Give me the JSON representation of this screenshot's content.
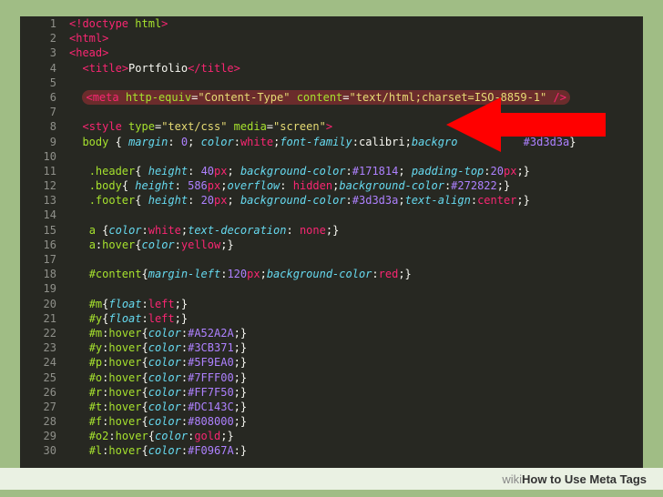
{
  "footer": {
    "brand": "wiki",
    "title": "How to Use Meta Tags"
  },
  "lines": [
    {
      "n": 1,
      "html": "<span class='t-br'>&lt;!</span><span class='t-tag'>doctype</span> <span class='t-attr'>html</span><span class='t-br'>&gt;</span>"
    },
    {
      "n": 2,
      "html": "<span class='t-br'>&lt;</span><span class='t-tag'>html</span><span class='t-br'>&gt;</span>"
    },
    {
      "n": 3,
      "html": "<span class='t-br'>&lt;</span><span class='t-tag'>head</span><span class='t-br'>&gt;</span>"
    },
    {
      "n": 4,
      "html": "  <span class='t-br'>&lt;</span><span class='t-tag'>title</span><span class='t-br'>&gt;</span><span class='t-text'>Portfolio</span><span class='t-br'>&lt;/</span><span class='t-tag'>title</span><span class='t-br'>&gt;</span>"
    },
    {
      "n": 5,
      "html": ""
    },
    {
      "n": 6,
      "html": "  <span class='hl'><span class='t-br'>&lt;</span><span class='t-tag'>meta</span> <span class='t-attr'>http-equiv</span><span class='t-punc'>=</span><span class='t-str'>\"Content-Type\"</span> <span class='t-attr'>content</span><span class='t-punc'>=</span><span class='t-str'>\"text/html;charset=ISO-8859-1\"</span> <span class='t-br'>/&gt;</span></span>"
    },
    {
      "n": 7,
      "html": ""
    },
    {
      "n": 8,
      "html": "  <span class='t-br'>&lt;</span><span class='t-tag'>style</span> <span class='t-attr'>type</span><span class='t-punc'>=</span><span class='t-str'>\"text/css\"</span> <span class='t-attr'>media</span><span class='t-punc'>=</span><span class='t-str'>\"screen\"</span><span class='t-br'>&gt;</span>"
    },
    {
      "n": 9,
      "html": "  <span class='t-sel'>body</span> <span class='t-punc'>{</span> <span class='t-prop'>margin</span><span class='t-punc'>:</span> <span class='t-num'>0</span><span class='t-punc'>;</span> <span class='t-prop'>color</span><span class='t-punc'>:</span><span class='t-key'>white</span><span class='t-punc'>;</span><span class='t-prop'>font-family</span><span class='t-punc'>:</span><span class='t-text'>calibri</span><span class='t-punc'>;</span><span class='t-prop'>backgro</span><span style='visibility:hidden'>und-color:</span><span class='t-num'>#3d3d3a</span><span class='t-punc'>}</span>"
    },
    {
      "n": 10,
      "html": ""
    },
    {
      "n": 11,
      "html": "   <span class='t-sel'>.header</span><span class='t-punc'>{</span> <span class='t-prop'>height</span><span class='t-punc'>:</span> <span class='t-num'>40</span><span class='t-key'>px</span><span class='t-punc'>;</span> <span class='t-prop'>background-color</span><span class='t-punc'>:</span><span class='t-num'>#171814</span><span class='t-punc'>;</span> <span class='t-prop'>padding-top</span><span class='t-punc'>:</span><span class='t-num'>20</span><span class='t-key'>px</span><span class='t-punc'>;}</span>"
    },
    {
      "n": 12,
      "html": "   <span class='t-sel'>.body</span><span class='t-punc'>{</span> <span class='t-prop'>height</span><span class='t-punc'>:</span> <span class='t-num'>586</span><span class='t-key'>px</span><span class='t-punc'>;</span><span class='t-prop'>overflow</span><span class='t-punc'>:</span> <span class='t-key'>hidden</span><span class='t-punc'>;</span><span class='t-prop'>background-color</span><span class='t-punc'>:</span><span class='t-num'>#272822</span><span class='t-punc'>;}</span>"
    },
    {
      "n": 13,
      "html": "   <span class='t-sel'>.footer</span><span class='t-punc'>{</span> <span class='t-prop'>height</span><span class='t-punc'>:</span> <span class='t-num'>20</span><span class='t-key'>px</span><span class='t-punc'>;</span> <span class='t-prop'>background-color</span><span class='t-punc'>:</span><span class='t-num'>#3d3d3a</span><span class='t-punc'>;</span><span class='t-prop'>text-align</span><span class='t-punc'>:</span><span class='t-key'>center</span><span class='t-punc'>;}</span>"
    },
    {
      "n": 14,
      "html": ""
    },
    {
      "n": 15,
      "html": "   <span class='t-sel'>a</span> <span class='t-punc'>{</span><span class='t-prop'>color</span><span class='t-punc'>:</span><span class='t-key'>white</span><span class='t-punc'>;</span><span class='t-prop'>text-decoration</span><span class='t-punc'>:</span> <span class='t-key'>none</span><span class='t-punc'>;}</span>"
    },
    {
      "n": 16,
      "html": "   <span class='t-sel'>a</span><span class='t-punc'>:</span><span class='t-sel'>hover</span><span class='t-punc'>{</span><span class='t-prop'>color</span><span class='t-punc'>:</span><span class='t-key'>yellow</span><span class='t-punc'>;}</span>"
    },
    {
      "n": 17,
      "html": ""
    },
    {
      "n": 18,
      "html": "   <span class='t-sel'>#content</span><span class='t-punc'>{</span><span class='t-prop'>margin-left</span><span class='t-punc'>:</span><span class='t-num'>120</span><span class='t-key'>px</span><span class='t-punc'>;</span><span class='t-prop'>background-color</span><span class='t-punc'>:</span><span class='t-key'>red</span><span class='t-punc'>;}</span>"
    },
    {
      "n": 19,
      "html": ""
    },
    {
      "n": 20,
      "html": "   <span class='t-sel'>#m</span><span class='t-punc'>{</span><span class='t-prop'>float</span><span class='t-punc'>:</span><span class='t-key'>left</span><span class='t-punc'>;}</span>"
    },
    {
      "n": 21,
      "html": "   <span class='t-sel'>#y</span><span class='t-punc'>{</span><span class='t-prop'>float</span><span class='t-punc'>:</span><span class='t-key'>left</span><span class='t-punc'>;}</span>"
    },
    {
      "n": 22,
      "html": "   <span class='t-sel'>#m</span><span class='t-punc'>:</span><span class='t-sel'>hover</span><span class='t-punc'>{</span><span class='t-prop'>color</span><span class='t-punc'>:</span><span class='t-num'>#A52A2A</span><span class='t-punc'>;}</span>"
    },
    {
      "n": 23,
      "html": "   <span class='t-sel'>#y</span><span class='t-punc'>:</span><span class='t-sel'>hover</span><span class='t-punc'>{</span><span class='t-prop'>color</span><span class='t-punc'>:</span><span class='t-num'>#3CB371</span><span class='t-punc'>;}</span>"
    },
    {
      "n": 24,
      "html": "   <span class='t-sel'>#p</span><span class='t-punc'>:</span><span class='t-sel'>hover</span><span class='t-punc'>{</span><span class='t-prop'>color</span><span class='t-punc'>:</span><span class='t-num'>#5F9EA0</span><span class='t-punc'>;}</span>"
    },
    {
      "n": 25,
      "html": "   <span class='t-sel'>#o</span><span class='t-punc'>:</span><span class='t-sel'>hover</span><span class='t-punc'>{</span><span class='t-prop'>color</span><span class='t-punc'>:</span><span class='t-num'>#7FFF00</span><span class='t-punc'>;}</span>"
    },
    {
      "n": 26,
      "html": "   <span class='t-sel'>#r</span><span class='t-punc'>:</span><span class='t-sel'>hover</span><span class='t-punc'>{</span><span class='t-prop'>color</span><span class='t-punc'>:</span><span class='t-num'>#FF7F50</span><span class='t-punc'>;}</span>"
    },
    {
      "n": 27,
      "html": "   <span class='t-sel'>#t</span><span class='t-punc'>:</span><span class='t-sel'>hover</span><span class='t-punc'>{</span><span class='t-prop'>color</span><span class='t-punc'>:</span><span class='t-num'>#DC143C</span><span class='t-punc'>;}</span>"
    },
    {
      "n": 28,
      "html": "   <span class='t-sel'>#f</span><span class='t-punc'>:</span><span class='t-sel'>hover</span><span class='t-punc'>{</span><span class='t-prop'>color</span><span class='t-punc'>:</span><span class='t-num'>#808000</span><span class='t-punc'>;}</span>"
    },
    {
      "n": 29,
      "html": "   <span class='t-sel'>#o2</span><span class='t-punc'>:</span><span class='t-sel'>hover</span><span class='t-punc'>{</span><span class='t-prop'>color</span><span class='t-punc'>:</span><span class='t-key'>gold</span><span class='t-punc'>;}</span>"
    },
    {
      "n": 30,
      "html": "   <span class='t-sel'>#l</span><span class='t-punc'>:</span><span class='t-sel'>hover</span><span class='t-punc'>{</span><span class='t-prop'>color</span><span class='t-punc'>:</span><span class='t-num'>#F0967A</span><span class='t-punc'>:}</span>"
    }
  ]
}
